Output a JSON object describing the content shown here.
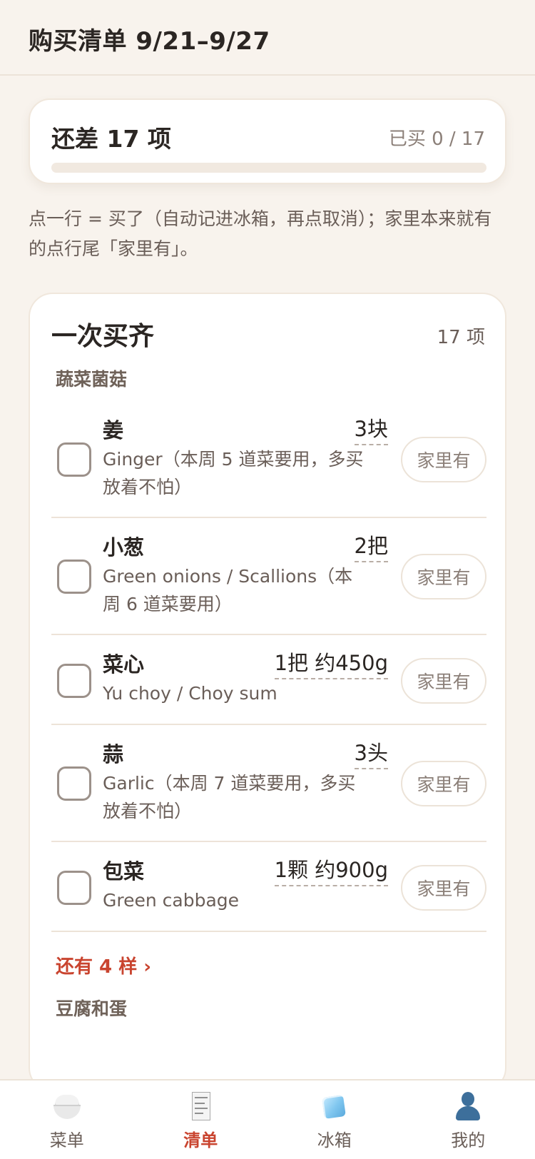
{
  "header": {
    "title": "购买清单 9/21–9/27"
  },
  "progress": {
    "remaining_label": "还差 17 项",
    "bought_label": "已买 0 / 17",
    "fraction": 0
  },
  "hint": "点一行 = 买了（自动记进冰箱，再点取消）；家里本来就有的点行尾「家里有」。",
  "section": {
    "title": "一次买齐",
    "count": "17 项",
    "categories": [
      "蔬菜菌菇",
      "豆腐和蛋"
    ],
    "more_link": "还有 4 样 ›",
    "items": [
      {
        "name": "姜",
        "qty": "3块",
        "desc": "Ginger（本周 5 道菜要用，多买放着不怕）",
        "home_label": "家里有"
      },
      {
        "name": "小葱",
        "qty": "2把",
        "desc": "Green onions / Scallions（本周 6 道菜要用）",
        "home_label": "家里有"
      },
      {
        "name": "菜心",
        "qty": "1把 约450g",
        "desc": "Yu choy / Choy sum",
        "home_label": "家里有"
      },
      {
        "name": "蒜",
        "qty": "3头",
        "desc": "Garlic（本周 7 道菜要用，多买放着不怕）",
        "home_label": "家里有"
      },
      {
        "name": "包菜",
        "qty": "1颗 约900g",
        "desc": "Green cabbage",
        "home_label": "家里有"
      }
    ]
  },
  "tabbar": {
    "tabs": [
      {
        "label": "菜单",
        "icon": "rice-bowl-icon"
      },
      {
        "label": "清单",
        "icon": "receipt-icon"
      },
      {
        "label": "冰箱",
        "icon": "ice-cube-icon"
      },
      {
        "label": "我的",
        "icon": "person-icon"
      }
    ],
    "active_color": "#c9442f"
  }
}
